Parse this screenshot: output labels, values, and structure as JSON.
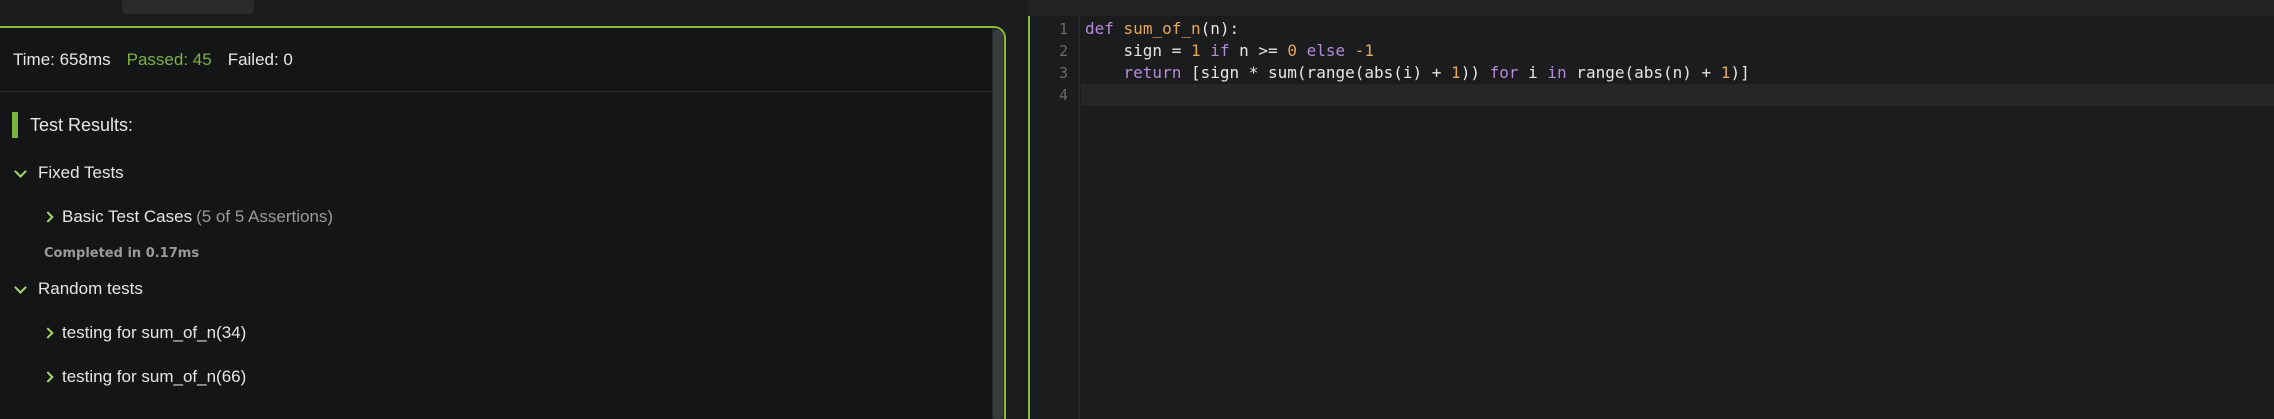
{
  "stats": {
    "time": "Time: 658ms",
    "passed": "Passed: 45",
    "failed": "Failed: 0"
  },
  "results": {
    "heading": "Test Results:",
    "groups": [
      {
        "label": "Fixed Tests",
        "items": [
          {
            "label": "Basic Test Cases",
            "assertions": "(5 of 5 Assertions)"
          }
        ],
        "completed": "Completed in 0.17ms"
      },
      {
        "label": "Random tests",
        "items": [
          {
            "label": "testing for sum_of_n(34)"
          },
          {
            "label": "testing for sum_of_n(66)"
          }
        ]
      }
    ]
  },
  "editor": {
    "line_numbers": [
      "1",
      "2",
      "3",
      "4"
    ],
    "code": {
      "l1_kw": "def",
      "l1_fn": "sum_of_n",
      "l1_rest": "(n):",
      "l2_a": "    sign = ",
      "l2_n1": "1",
      "l2_if": " if",
      "l2_b": " n >= ",
      "l2_n2": "0",
      "l2_else": " else",
      "l2_c": " -1",
      "l3_ret": "    return",
      "l3_a": " [sign * sum(range(abs(i) + ",
      "l3_n1": "1",
      "l3_b": ")) ",
      "l3_for": "for",
      "l3_c": " i ",
      "l3_in": "in",
      "l3_d": " range(abs(n) + ",
      "l3_n2": "1",
      "l3_e": ")]"
    }
  },
  "colors": {
    "accent_green": "#8dbb36",
    "passed_green": "#7cb342",
    "keyword": "#b58adb",
    "function": "#e8a85a"
  }
}
